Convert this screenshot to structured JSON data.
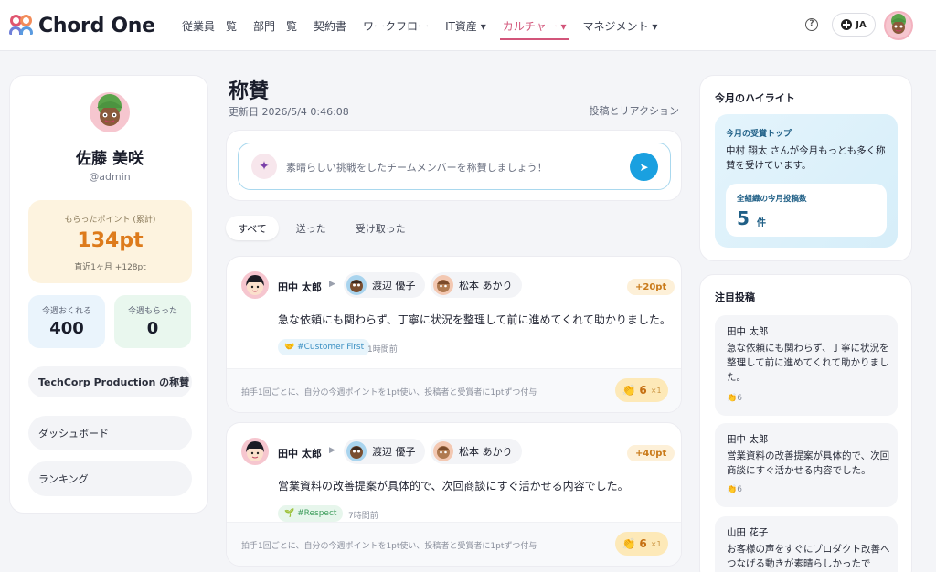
{
  "app": {
    "name": "Chord One"
  },
  "nav": {
    "items": [
      {
        "label": "従業員一覧"
      },
      {
        "label": "部門一覧"
      },
      {
        "label": "契約書"
      },
      {
        "label": "ワークフロー"
      },
      {
        "label": "IT資産 ▾"
      },
      {
        "label": "カルチャー ▾"
      },
      {
        "label": "マネジメント ▾"
      }
    ],
    "lang": "JA"
  },
  "profile": {
    "name": "佐藤 美咲",
    "handle": "@admin",
    "points_label": "もらったポイント (累計)",
    "points_value": "134pt",
    "points_sub": "直近1ヶ月 +128pt",
    "give_label": "今週おくれる",
    "give_value": "400",
    "got_label": "今週もらった",
    "got_value": "0",
    "org_button": "TechCorp Production の称賛",
    "dashboard": "ダッシュボード",
    "ranking": "ランキング"
  },
  "main": {
    "title": "称賛",
    "updated": "更新日 2026/5/4 0:46:08",
    "posts_reactions": "投稿とリアクション",
    "compose_placeholder": "素晴らしい挑戦をしたチームメンバーを称賛しましょう！",
    "tabs": [
      {
        "label": "すべて"
      },
      {
        "label": "送った"
      },
      {
        "label": "受け取った"
      }
    ],
    "posts": [
      {
        "from": "田中 太郎",
        "to1": "渡辺 優子",
        "to2": "松本 あかり",
        "points": "+20pt",
        "body": "急な依頼にも関わらず、丁寧に状況を整理して前に進めてくれて助かりました。",
        "tag": "#Customer First",
        "time": "1時間前",
        "note": "拍手1回ごとに、自分の今週ポイントを1pt使い、投稿者と受賞者に1ptずつ付与",
        "claps": "6",
        "mine": "×1"
      },
      {
        "from": "田中 太郎",
        "to1": "渡辺 優子",
        "to2": "松本 あかり",
        "points": "+40pt",
        "body": "営業資料の改善提案が具体的で、次回商談にすぐ活かせる内容でした。",
        "tag": "#Respect",
        "time": "7時間前",
        "note": "拍手1回ごとに、自分の今週ポイントを1pt使い、投稿者と受賞者に1ptずつ付与",
        "claps": "6",
        "mine": "×1"
      }
    ]
  },
  "right": {
    "highlight_title": "今月のハイライト",
    "award_title": "今月の受賞トップ",
    "award_text": "中村 翔太 さんが今月もっとも多く称賛を受けています。",
    "org_posts_label": "全組織の今月投稿数",
    "org_posts_value": "5",
    "org_posts_unit": "件",
    "featured_title": "注目投稿",
    "featured": [
      {
        "name": "田中 太郎",
        "text": "急な依頼にも関わらず、丁寧に状況を整理して前に進めてくれて助かりました。",
        "claps": "6"
      },
      {
        "name": "田中 太郎",
        "text": "営業資料の改善提案が具体的で、次回商談にすぐ活かせる内容でした。",
        "claps": "6"
      },
      {
        "name": "山田 花子",
        "text": "お客様の声をすぐにプロダクト改善へつなげる動きが素晴らしかったで"
      }
    ]
  },
  "colors": {
    "accent": "#d2557a",
    "points": "#dd7b1c",
    "send": "#1aa0e0"
  }
}
